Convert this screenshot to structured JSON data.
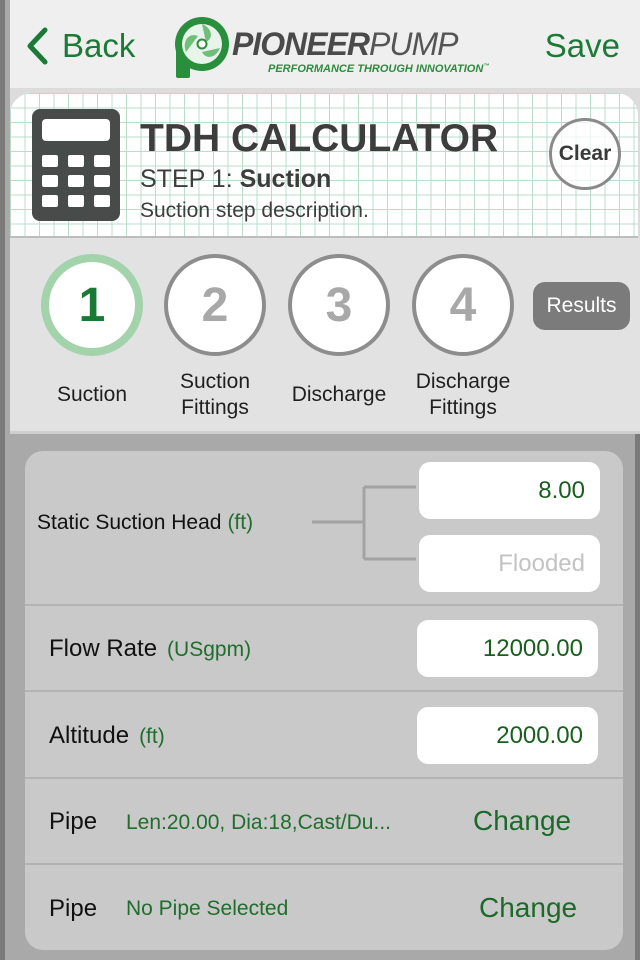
{
  "navbar": {
    "back_label": "Back",
    "save_label": "Save",
    "logo": {
      "brand_bold": "PIONEER",
      "brand_light": "PUMP",
      "tagline": "PERFORMANCE THROUGH INNOVATION",
      "trademark": "™"
    }
  },
  "header": {
    "title": "TDH CALCULATOR",
    "step_prefix": "STEP 1:",
    "step_name": "Suction",
    "description": "Suction step description.",
    "clear_label": "Clear",
    "icon": "calculator-icon"
  },
  "steps": {
    "items": [
      {
        "number": "1",
        "label_line1": "Suction",
        "label_line2": "",
        "active": true
      },
      {
        "number": "2",
        "label_line1": "Suction",
        "label_line2": "Fittings",
        "active": false
      },
      {
        "number": "3",
        "label_line1": "Discharge",
        "label_line2": "",
        "active": false
      },
      {
        "number": "4",
        "label_line1": "Discharge",
        "label_line2": "Fittings",
        "active": false
      }
    ],
    "results_label": "Results"
  },
  "form": {
    "static_suction_head": {
      "label": "Static Suction Head",
      "unit": "(ft)",
      "value": "8.00",
      "flooded_placeholder": "Flooded"
    },
    "flow_rate": {
      "label": "Flow Rate",
      "unit": "(USgpm)",
      "value": "12000.00"
    },
    "altitude": {
      "label": "Altitude",
      "unit": "(ft)",
      "value": "2000.00"
    },
    "pipes": [
      {
        "label": "Pipe",
        "value": "Len:20.00, Dia:18,Cast/Du...",
        "action": "Change"
      },
      {
        "label": "Pipe",
        "value": "No Pipe Selected",
        "action": "Change"
      }
    ]
  },
  "colors": {
    "accent_green": "#1b7a35",
    "active_step_ring": "#a2d3ab",
    "value_green": "#1a5e1e"
  }
}
